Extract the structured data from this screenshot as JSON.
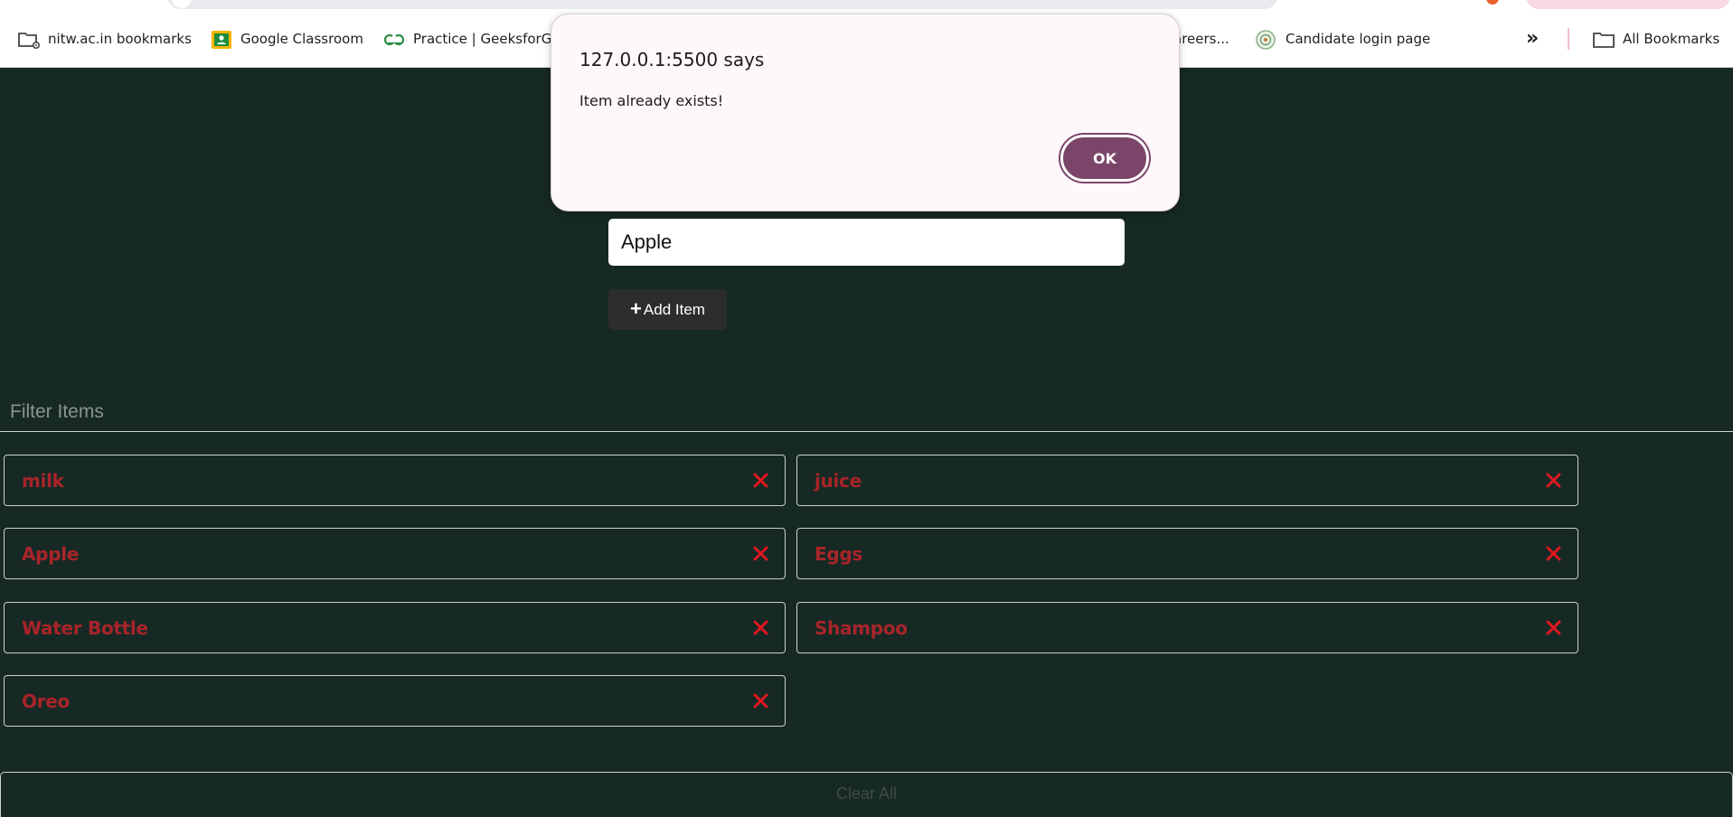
{
  "browser": {
    "bookmarks": [
      {
        "label": "nitw.ac.in bookmarks",
        "icon": "folder-gear-icon"
      },
      {
        "label": "Google Classroom",
        "icon": "google-classroom-icon"
      },
      {
        "label": "Practice | GeeksforGee",
        "icon": "geeksforgeeks-icon"
      },
      {
        "label": "areers...",
        "icon": "none"
      },
      {
        "label": "Candidate login page",
        "icon": "site-emblem-icon"
      }
    ],
    "overflow_label": "»",
    "all_bookmarks_label": "All Bookmarks"
  },
  "alert": {
    "title": "127.0.0.1:5500 says",
    "message": "Item already exists!",
    "ok_label": "OK",
    "accent_color": "#7b4569"
  },
  "form": {
    "item_input_value": "Apple",
    "add_button_label": "Add Item",
    "add_icon": "plus-icon"
  },
  "filter": {
    "placeholder": "Filter Items"
  },
  "items": [
    {
      "label": "milk"
    },
    {
      "label": "juice"
    },
    {
      "label": "Apple"
    },
    {
      "label": "Eggs"
    },
    {
      "label": "Water Bottle"
    },
    {
      "label": "Shampoo"
    },
    {
      "label": "Oreo"
    }
  ],
  "remove_icon": "x-icon",
  "clear_button_label": "Clear All",
  "colors": {
    "background": "#172924",
    "item_text": "#a8242a",
    "remove_icon": "#e0181f"
  }
}
